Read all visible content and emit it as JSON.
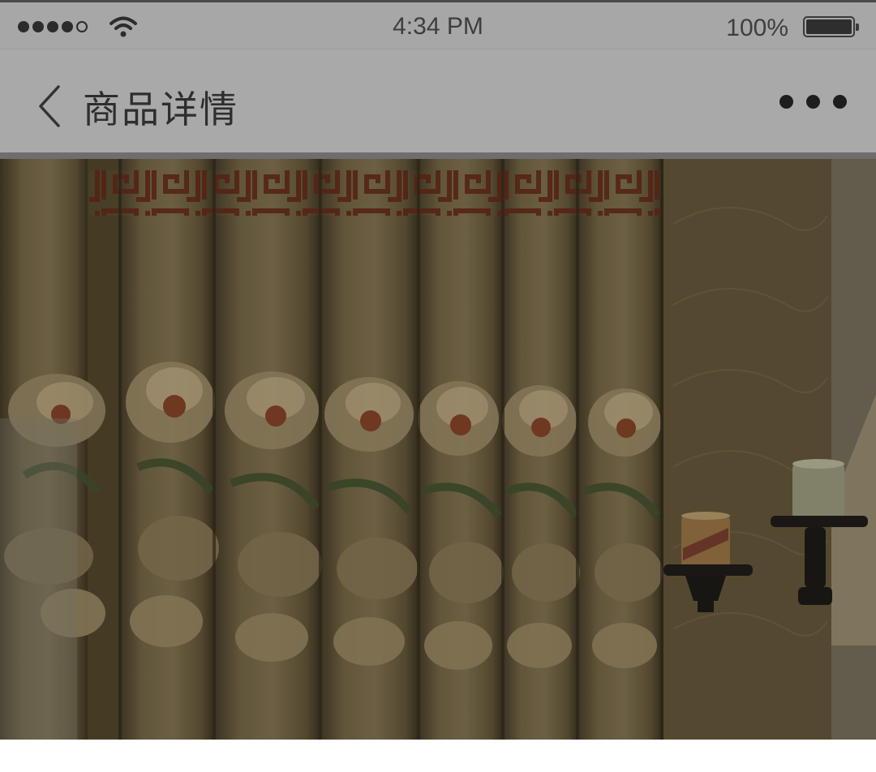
{
  "status_bar": {
    "time": "4:34 PM",
    "battery": "100%"
  },
  "nav": {
    "title": "商品详情"
  },
  "icons": {
    "back": "chevron-left-icon",
    "more": "more-horizontal-icon",
    "wifi": "wifi-icon",
    "battery": "battery-icon",
    "signal": "signal-dots-icon"
  },
  "colors": {
    "status_bar_bg": "#a7a7a7",
    "nav_bar_bg": "#a9a9a9",
    "curtain_base": "#5e5236",
    "embroidery_red": "#5a1e12"
  }
}
